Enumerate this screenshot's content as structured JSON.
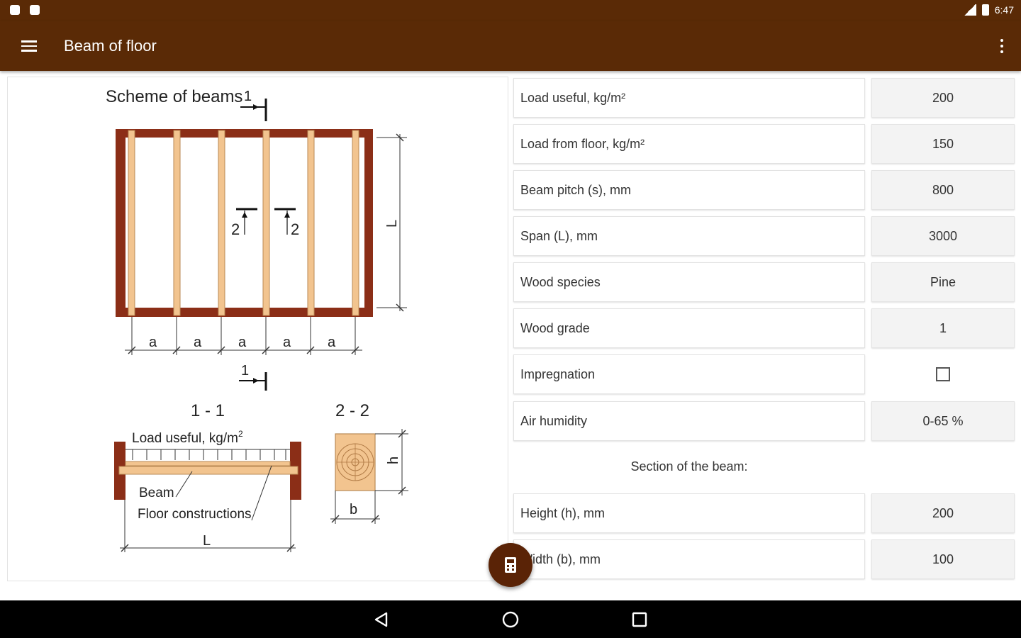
{
  "status_bar": {
    "time": "6:47"
  },
  "app_bar": {
    "title": "Beam of floor"
  },
  "scheme": {
    "title": "Scheme of beams",
    "section_1_mark": "1",
    "section_2_mark": "2",
    "pitch_label": "a",
    "span_label": "L",
    "section_1_1_title": "1 - 1",
    "section_2_2_title": "2 - 2",
    "load_label": "Load useful, kg/m",
    "load_unit_sup": "2",
    "beam_label": "Beam",
    "floor_label": "Floor constructions",
    "height_label": "h",
    "width_label": "b"
  },
  "inputs": [
    {
      "label": "Load useful, kg/m²",
      "value": "200"
    },
    {
      "label": "Load from floor, kg/m²",
      "value": "150"
    },
    {
      "label": "Beam pitch (s), mm",
      "value": "800"
    },
    {
      "label": "Span (L), mm",
      "value": "3000"
    },
    {
      "label": "Wood species",
      "value": "Pine"
    },
    {
      "label": "Wood grade",
      "value": "1"
    },
    {
      "label": "Impregnation",
      "checked": false
    },
    {
      "label": "Air humidity",
      "value": "0-65 %"
    }
  ],
  "section_title": "Section of the beam:",
  "section_inputs": [
    {
      "label": "Height (h), mm",
      "value": "200"
    },
    {
      "label": "Width (b), mm",
      "value": "100"
    }
  ],
  "colors": {
    "primary": "#5a2a06",
    "wall": "#8b2e17",
    "beam": "#f2c48f",
    "fab": "#5a2306"
  },
  "icons": {
    "menu": "menu-icon",
    "more": "more-vert-icon",
    "fab": "calculator-icon",
    "nav_back": "back-triangle-icon",
    "nav_home": "home-circle-icon",
    "nav_recents": "recents-square-icon"
  }
}
